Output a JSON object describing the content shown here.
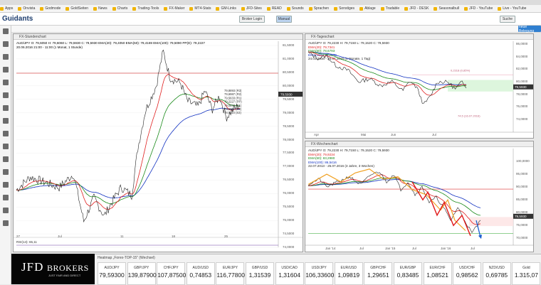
{
  "browser": {
    "bookmarks": [
      "Apps",
      "Onvista",
      "Godmode",
      "GoldSeiten",
      "News",
      "Charts",
      "Trading-Tools",
      "FX-Maker",
      "MT4-Stats",
      "GM-Links",
      "JFD-Sites",
      "READ",
      "Sounds",
      "Sprachen",
      "Sonstiges",
      "Ablage",
      "Tradable",
      "JFD - DESK",
      "Seasonalbull",
      "JFD - YouTube",
      "Live - YouTube"
    ]
  },
  "app": {
    "logo": "Guidants",
    "btn_broker": "Broker Login",
    "btn_manual": "Manual",
    "btn_search": "Suche",
    "btn_new": "neue Belegung"
  },
  "left_chart": {
    "title": "FX-Stundenchart",
    "legend1": "AUD/JPY O: 79,6050  H: 79,6060  L: 79,5930  C: 79,5930   EMA(20): 79,4050   EMA(50): 79,4169   EMA(100): 79,5090   PP(D): 79,2227",
    "legend2": "20.06.2016 21:00 - 11:00 (1 Monat, 1 Stunde)",
    "y_labels": [
      "81,5000",
      "81,0000",
      "80,5000",
      "80,0000",
      "79,5000",
      "79,0000",
      "78,5000",
      "78,0000",
      "77,5000",
      "77,0000",
      "76,5000",
      "76,0000",
      "75,5000",
      "75,0000",
      "74,5000",
      "74,0000"
    ],
    "current": "79,5930",
    "x_labels": [
      "27",
      "Jul",
      "11",
      "18",
      "25"
    ],
    "pivots": [
      "79,8893 (R3)",
      "79,6987 (R2)",
      "79,5633 (R1)",
      "79,2227 (PP)",
      "79,0873 (S1)",
      "78,8967 (S2)",
      "78,5113 (S3)"
    ],
    "rsi_label": "RSI(14): 65,11"
  },
  "top_right_chart": {
    "title": "FX-Tageschart",
    "legend": [
      "AUD/JPY  O: 79,2230  H: 79,7150  L: 79,1520  C: 79,5930",
      "EMA(20): 79,7341",
      "EMA(50): 78,6793",
      "EMA(100): 79,7639",
      "24.03.2016 - 25.07.2016 (4 Monate, 1 Tag)"
    ],
    "y_labels": [
      "86,0000",
      "84,0000",
      "82,0000",
      "80,0000",
      "78,0000",
      "76,0000",
      "74,0000"
    ],
    "x_labels": [
      "Apr",
      "Mai",
      "Jun",
      "Jul"
    ],
    "current": "79,5930",
    "annotation1": "0,2318 (0,85%)",
    "annotation2": "74,5 (16.07.2016)"
  },
  "bottom_right_chart": {
    "title": "FX-Wochenchart",
    "legend": [
      "AUD/JPY  O: 79,2230  H: 79,7150  L: 79,1520  C: 79,5930",
      "EMA(20): 79,9234",
      "EMA(50): 83,2980",
      "EMA(100): 86,5416",
      "22.07.2013 - 25.07.2016 (3 Jahre, 3 Wochen)"
    ],
    "y_labels": [
      "100,0000",
      "95,0000",
      "90,0000",
      "85,0000",
      "80,0000",
      "75,0000",
      "70,0000"
    ],
    "x_labels": [
      "Jan '14",
      "Jul",
      "Jan '15",
      "Jul",
      "Jan '16",
      "Jul"
    ],
    "current": "79,5930"
  },
  "ticker": {
    "title": "Heatmap „Forex-TOP-15\" (Wechsel)",
    "items": [
      {
        "sym": "AUD/JPY",
        "val": "79,59300"
      },
      {
        "sym": "GBP/JPY",
        "val": "139,87900"
      },
      {
        "sym": "CHF/JPY",
        "val": "107,87500"
      },
      {
        "sym": "AUD/USD",
        "val": "0,74853"
      },
      {
        "sym": "EUR/JPY",
        "val": "116,77800"
      },
      {
        "sym": "GBP/USD",
        "val": "1,31539"
      },
      {
        "sym": "USD/CAD",
        "val": "1,31604"
      },
      {
        "sym": "USD/JPY",
        "val": "106,33600"
      },
      {
        "sym": "EUR/USD",
        "val": "1,09819"
      },
      {
        "sym": "GBP/CHF",
        "val": "1,29651"
      },
      {
        "sym": "EUR/GBP",
        "val": "0,83485"
      },
      {
        "sym": "EUR/CHF",
        "val": "1,08521"
      },
      {
        "sym": "USD/CHF",
        "val": "0,98562"
      },
      {
        "sym": "NZD/USD",
        "val": "0,69785"
      },
      {
        "sym": "Gold",
        "val": "1.315,07"
      }
    ]
  },
  "jfd": {
    "name": "JFD",
    "brokers": "BROKERS",
    "tag": "JUST FAIR AND DIRECT"
  },
  "colors": {
    "ema20": "#e02020",
    "ema50": "#1a8a1a",
    "ema100": "#1030c0",
    "price": "#222222",
    "accent": "#1a6fc7"
  }
}
